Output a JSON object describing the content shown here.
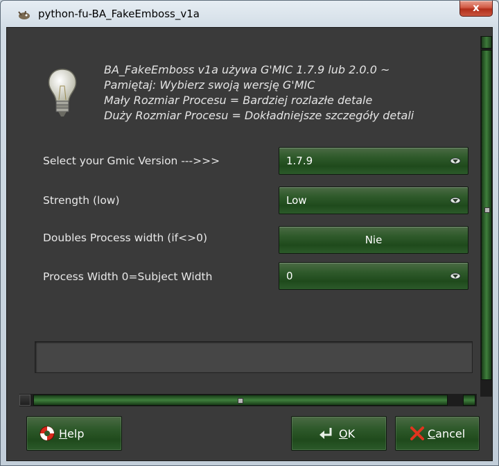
{
  "window": {
    "title": "python-fu-BA_FakeEmboss_v1a",
    "close_label": "x"
  },
  "info": {
    "lines": [
      "BA_FakeEmboss v1a używa G'MIC 1.7.9 lub 2.0.0 ~",
      "Pamiętaj: Wybierz swoją wersję G'MIC",
      "Mały Rozmiar Procesu = Bardziej rozlazłe detale",
      "Duży Rozmiar Procesu = Dokładniejsze szczegóły detali"
    ]
  },
  "fields": {
    "gmic_version": {
      "label": "Select your Gmic Version --->>>",
      "value": "1.7.9"
    },
    "strength": {
      "label": "Strength (low)",
      "value": "Low"
    },
    "doubles_width": {
      "label": "Doubles Process width (if<>0)",
      "value": "Nie"
    },
    "process_width": {
      "label": "Process Width     0=Subject Width",
      "value": "0"
    }
  },
  "buttons": {
    "help": {
      "mnemonic": "H",
      "rest": "elp"
    },
    "ok": {
      "mnemonic": "O",
      "rest": "K"
    },
    "cancel": {
      "mnemonic": "C",
      "rest": "ancel"
    }
  },
  "colors": {
    "panel_bg": "#3a3a3a",
    "button_green": "#2f5a2b",
    "text": "#e8e8e8"
  },
  "icons": [
    "wilber-icon",
    "lightbulb-icon",
    "dropdown-arrow-icon",
    "lifebuoy-icon",
    "ok-arrow-icon",
    "cancel-x-icon"
  ]
}
